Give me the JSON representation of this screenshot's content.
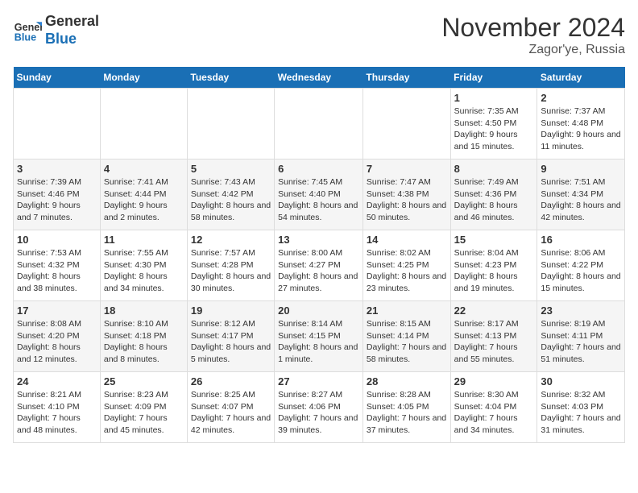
{
  "header": {
    "logo_line1": "General",
    "logo_line2": "Blue",
    "month": "November 2024",
    "location": "Zagor'ye, Russia"
  },
  "weekdays": [
    "Sunday",
    "Monday",
    "Tuesday",
    "Wednesday",
    "Thursday",
    "Friday",
    "Saturday"
  ],
  "weeks": [
    [
      {
        "day": "",
        "info": ""
      },
      {
        "day": "",
        "info": ""
      },
      {
        "day": "",
        "info": ""
      },
      {
        "day": "",
        "info": ""
      },
      {
        "day": "",
        "info": ""
      },
      {
        "day": "1",
        "info": "Sunrise: 7:35 AM\nSunset: 4:50 PM\nDaylight: 9 hours and 15 minutes."
      },
      {
        "day": "2",
        "info": "Sunrise: 7:37 AM\nSunset: 4:48 PM\nDaylight: 9 hours and 11 minutes."
      }
    ],
    [
      {
        "day": "3",
        "info": "Sunrise: 7:39 AM\nSunset: 4:46 PM\nDaylight: 9 hours and 7 minutes."
      },
      {
        "day": "4",
        "info": "Sunrise: 7:41 AM\nSunset: 4:44 PM\nDaylight: 9 hours and 2 minutes."
      },
      {
        "day": "5",
        "info": "Sunrise: 7:43 AM\nSunset: 4:42 PM\nDaylight: 8 hours and 58 minutes."
      },
      {
        "day": "6",
        "info": "Sunrise: 7:45 AM\nSunset: 4:40 PM\nDaylight: 8 hours and 54 minutes."
      },
      {
        "day": "7",
        "info": "Sunrise: 7:47 AM\nSunset: 4:38 PM\nDaylight: 8 hours and 50 minutes."
      },
      {
        "day": "8",
        "info": "Sunrise: 7:49 AM\nSunset: 4:36 PM\nDaylight: 8 hours and 46 minutes."
      },
      {
        "day": "9",
        "info": "Sunrise: 7:51 AM\nSunset: 4:34 PM\nDaylight: 8 hours and 42 minutes."
      }
    ],
    [
      {
        "day": "10",
        "info": "Sunrise: 7:53 AM\nSunset: 4:32 PM\nDaylight: 8 hours and 38 minutes."
      },
      {
        "day": "11",
        "info": "Sunrise: 7:55 AM\nSunset: 4:30 PM\nDaylight: 8 hours and 34 minutes."
      },
      {
        "day": "12",
        "info": "Sunrise: 7:57 AM\nSunset: 4:28 PM\nDaylight: 8 hours and 30 minutes."
      },
      {
        "day": "13",
        "info": "Sunrise: 8:00 AM\nSunset: 4:27 PM\nDaylight: 8 hours and 27 minutes."
      },
      {
        "day": "14",
        "info": "Sunrise: 8:02 AM\nSunset: 4:25 PM\nDaylight: 8 hours and 23 minutes."
      },
      {
        "day": "15",
        "info": "Sunrise: 8:04 AM\nSunset: 4:23 PM\nDaylight: 8 hours and 19 minutes."
      },
      {
        "day": "16",
        "info": "Sunrise: 8:06 AM\nSunset: 4:22 PM\nDaylight: 8 hours and 15 minutes."
      }
    ],
    [
      {
        "day": "17",
        "info": "Sunrise: 8:08 AM\nSunset: 4:20 PM\nDaylight: 8 hours and 12 minutes."
      },
      {
        "day": "18",
        "info": "Sunrise: 8:10 AM\nSunset: 4:18 PM\nDaylight: 8 hours and 8 minutes."
      },
      {
        "day": "19",
        "info": "Sunrise: 8:12 AM\nSunset: 4:17 PM\nDaylight: 8 hours and 5 minutes."
      },
      {
        "day": "20",
        "info": "Sunrise: 8:14 AM\nSunset: 4:15 PM\nDaylight: 8 hours and 1 minute."
      },
      {
        "day": "21",
        "info": "Sunrise: 8:15 AM\nSunset: 4:14 PM\nDaylight: 7 hours and 58 minutes."
      },
      {
        "day": "22",
        "info": "Sunrise: 8:17 AM\nSunset: 4:13 PM\nDaylight: 7 hours and 55 minutes."
      },
      {
        "day": "23",
        "info": "Sunrise: 8:19 AM\nSunset: 4:11 PM\nDaylight: 7 hours and 51 minutes."
      }
    ],
    [
      {
        "day": "24",
        "info": "Sunrise: 8:21 AM\nSunset: 4:10 PM\nDaylight: 7 hours and 48 minutes."
      },
      {
        "day": "25",
        "info": "Sunrise: 8:23 AM\nSunset: 4:09 PM\nDaylight: 7 hours and 45 minutes."
      },
      {
        "day": "26",
        "info": "Sunrise: 8:25 AM\nSunset: 4:07 PM\nDaylight: 7 hours and 42 minutes."
      },
      {
        "day": "27",
        "info": "Sunrise: 8:27 AM\nSunset: 4:06 PM\nDaylight: 7 hours and 39 minutes."
      },
      {
        "day": "28",
        "info": "Sunrise: 8:28 AM\nSunset: 4:05 PM\nDaylight: 7 hours and 37 minutes."
      },
      {
        "day": "29",
        "info": "Sunrise: 8:30 AM\nSunset: 4:04 PM\nDaylight: 7 hours and 34 minutes."
      },
      {
        "day": "30",
        "info": "Sunrise: 8:32 AM\nSunset: 4:03 PM\nDaylight: 7 hours and 31 minutes."
      }
    ]
  ]
}
